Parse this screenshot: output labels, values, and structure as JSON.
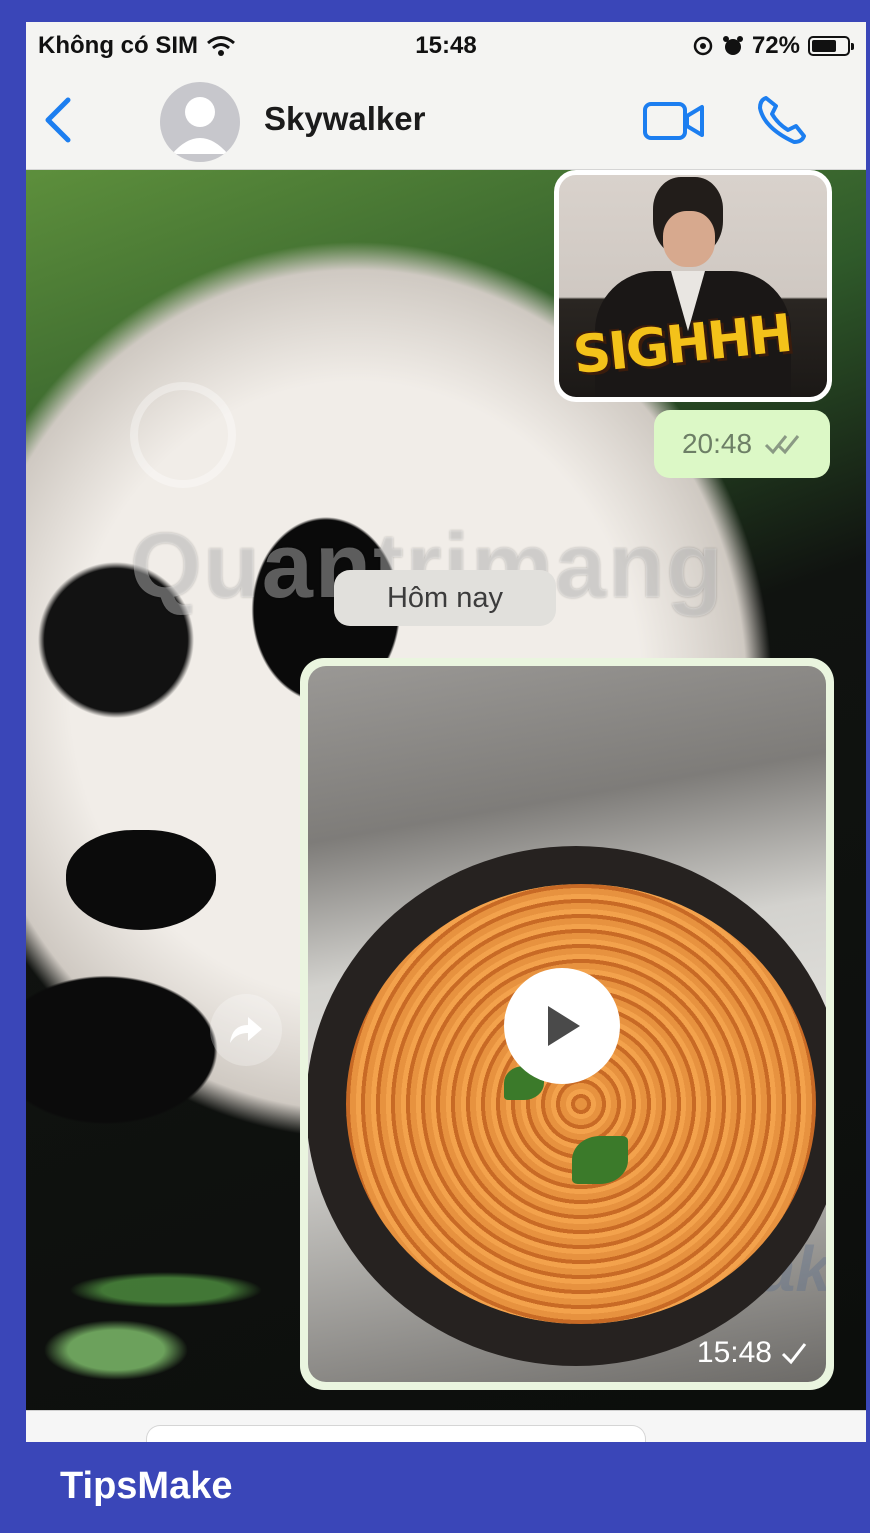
{
  "status_bar": {
    "carrier": "Không có SIM",
    "time": "15:48",
    "battery": "72%",
    "battery_level": 0.72
  },
  "header": {
    "contact_name": "Skywalker",
    "back_icon": "chevron-left-icon",
    "video_icon": "video-camera-icon",
    "call_icon": "phone-icon"
  },
  "messages": {
    "sticker_text": "SIGHHH",
    "sticker_time": "20:48",
    "day_separator": "Hôm nay",
    "video_time": "15:48"
  },
  "watermarks": {
    "site": "Quantrimang",
    "tipsmake": "TipsMake"
  },
  "footer": {
    "brand": "TipsMake"
  },
  "colors": {
    "frame": "#3a46b8",
    "accent": "#1c7ef0",
    "bubble_green": "#dcf8c6"
  }
}
